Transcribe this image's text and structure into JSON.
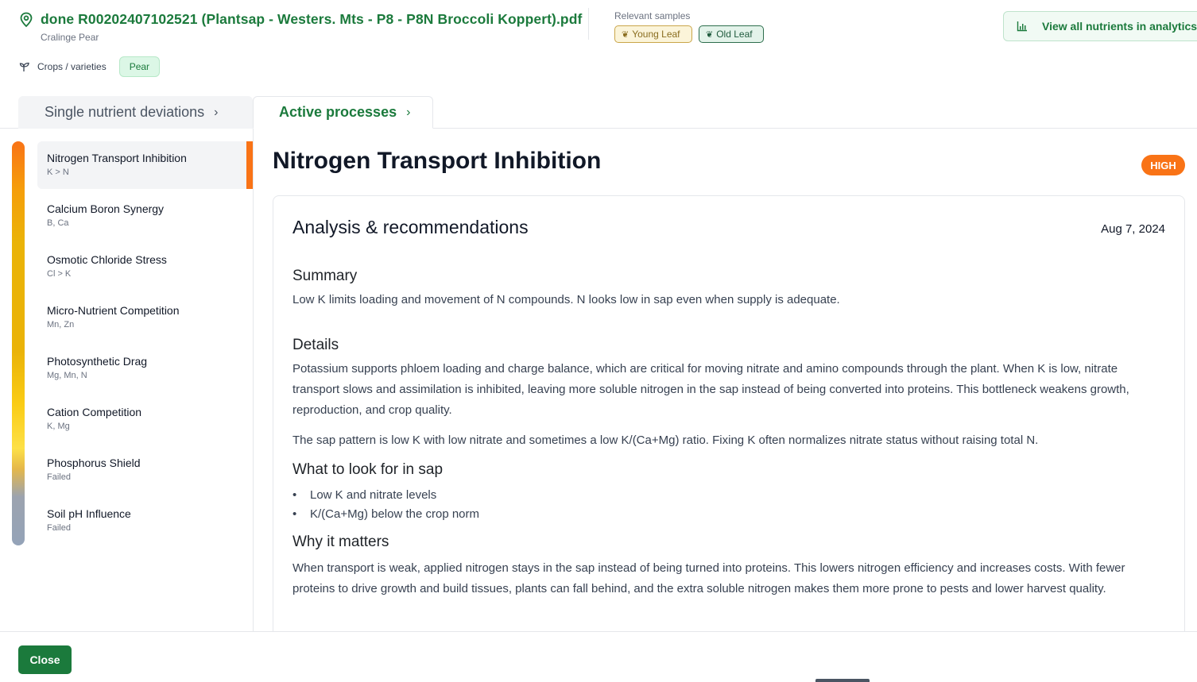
{
  "header": {
    "file_title": "done R00202407102521 (Plantsap - Westers. Mts - P8 - P8N Broccoli Koppert).pdf",
    "subtitle": "Cralinge Pear",
    "relevant_samples_label": "Relevant samples",
    "samples": [
      {
        "label": "Young Leaf",
        "icon": "leaf-icon"
      },
      {
        "label": "Old Leaf",
        "icon": "leaf-icon"
      }
    ],
    "analytics_button_label": "View all nutrients in analytics",
    "crops_label": "Crops / varieties",
    "crop_chip": "Pear"
  },
  "tabs": {
    "single": "Single nutrient deviations",
    "active": "Active processes",
    "chevron": "›"
  },
  "sidebar": {
    "items": [
      {
        "name": "Nitrogen Transport Inhibition",
        "sub": "K > N"
      },
      {
        "name": "Calcium Boron Synergy",
        "sub": "B, Ca"
      },
      {
        "name": "Osmotic Chloride Stress",
        "sub": "Cl > K"
      },
      {
        "name": "Micro-Nutrient Competition",
        "sub": "Mn, Zn"
      },
      {
        "name": "Photosynthetic Drag",
        "sub": "Mg, Mn, N"
      },
      {
        "name": "Cation Competition",
        "sub": "K, Mg"
      },
      {
        "name": "Phosphorus Shield",
        "sub": "Failed"
      },
      {
        "name": "Soil pH Influence",
        "sub": "Failed"
      }
    ]
  },
  "main": {
    "title": "Nitrogen Transport Inhibition",
    "severity": "HIGH",
    "card_title": "Analysis & recommendations",
    "date": "Aug 7, 2024",
    "summary_heading": "Summary",
    "summary_text": "Low K limits loading and movement of N compounds. N looks low in sap even when supply is adequate.",
    "details_heading": "Details",
    "details_p1": "Potassium supports phloem loading and charge balance, which are critical for moving nitrate and amino compounds through the plant. When K is low, nitrate transport slows and assimilation is inhibited, leaving more soluble nitrogen in the sap instead of being converted into proteins. This bottleneck weakens growth, reproduction, and crop quality.",
    "details_p2": "The sap pattern is low K with low nitrate and sometimes a low K/(Ca+Mg) ratio. Fixing K often normalizes nitrate status without raising total N.",
    "look_heading": "What to look for in sap",
    "look_items": [
      "Low K and nitrate levels",
      "K/(Ca+Mg) below the crop norm"
    ],
    "why_heading": "Why it matters",
    "why_text": "When transport is weak, applied nitrogen stays in the sap instead of being turned into proteins. This lowers nitrogen efficiency and increases costs. With fewer proteins to drive growth and build tissues, plants can fall behind, and the extra soluble nitrogen makes them more prone to pests and lower harvest quality."
  },
  "footer": {
    "close_label": "Close"
  },
  "colors": {
    "brand_green": "#1b7a3c",
    "severity_high": "#f97316"
  }
}
